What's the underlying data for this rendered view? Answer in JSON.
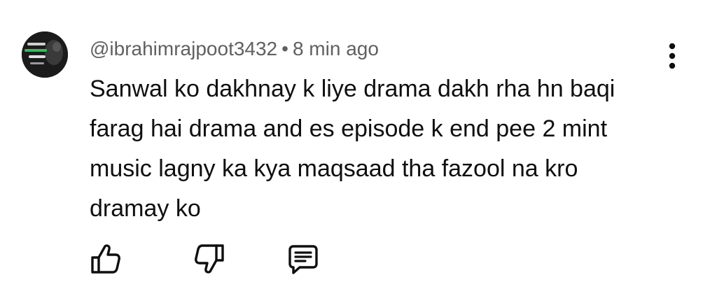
{
  "comment": {
    "author": "@ibrahimrajpoot3432",
    "separator": "•",
    "timestamp": "8 min ago",
    "text": "Sanwal ko dakhnay k liye drama dakh rha hn baqi farag hai drama and es episode k end pee 2 mint music lagny ka kya maqsaad tha fazool na kro dramay ko"
  },
  "icons": {
    "avatar": "avatar-image",
    "more": "more-vertical-icon",
    "like": "thumbs-up-icon",
    "dislike": "thumbs-down-icon",
    "reply": "reply-comment-icon"
  },
  "colors": {
    "text": "#0f0f0f",
    "meta": "#606060",
    "icon": "#0f0f0f",
    "avatar_bg": "#1b1b1b",
    "avatar_accent": "#2fbf5a"
  }
}
